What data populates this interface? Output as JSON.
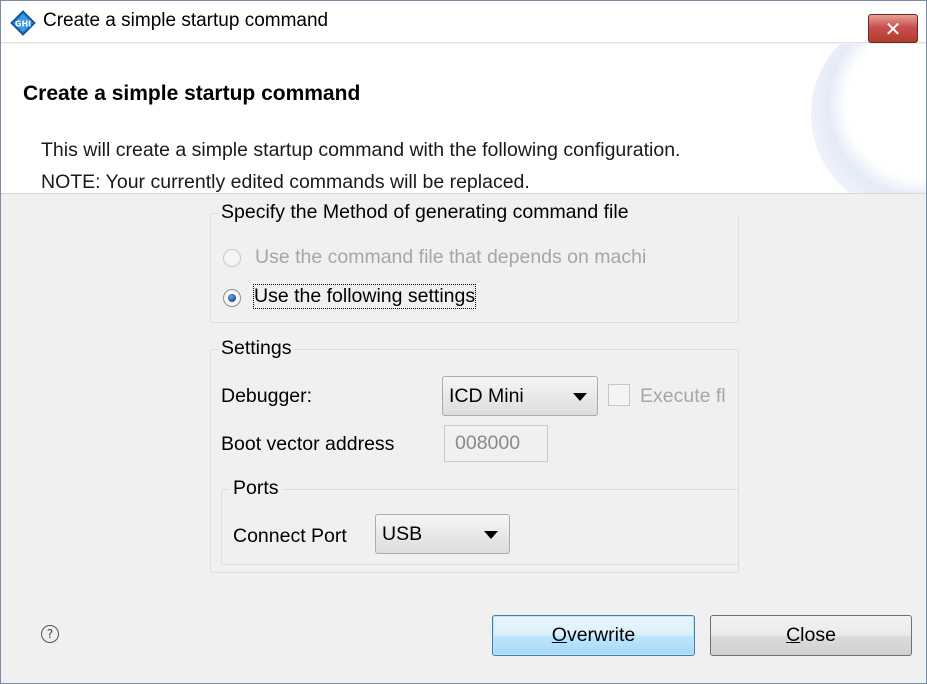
{
  "window": {
    "title": "Create a simple startup command",
    "close_symbol": "✕",
    "icon": "ghs-app-icon"
  },
  "banner": {
    "title": "Create a simple startup command",
    "description_line1": "This will create a simple startup command with the following configuration.",
    "description_line2": "NOTE: Your currently edited commands will be replaced."
  },
  "method_group": {
    "label": "Specify the Method of generating command file",
    "option_machine": "Use the command file that depends on machi",
    "option_settings": "Use the following settings",
    "selected": "option_settings"
  },
  "settings_group": {
    "label": "Settings",
    "debugger_label": "Debugger:",
    "debugger_value": "ICD Mini",
    "execute_label": "Execute fl",
    "boot_vector_label": "Boot vector address",
    "boot_vector_value": "008000"
  },
  "ports_group": {
    "label": "Ports",
    "connect_port_label": "Connect Port",
    "connect_port_value": "USB"
  },
  "buttons": {
    "overwrite": "Overwrite",
    "close": "Close"
  },
  "help": {
    "symbol": "?",
    "icon": "help-icon"
  },
  "colors": {
    "close_button": "#c75050",
    "default_button": "#bee6fd",
    "radio_dot": "#1a4f9c"
  }
}
